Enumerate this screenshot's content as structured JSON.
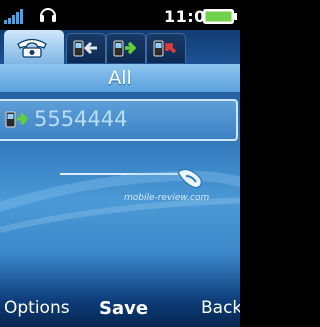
{
  "status_bar": {
    "time": "11:07",
    "signal_icon": "signal-bars-icon",
    "headset_icon": "headset-icon",
    "battery_icon": "battery-full-icon",
    "accent_colors": {
      "signal": "#4aa3e8",
      "battery": "#6fd24a"
    }
  },
  "tabs": [
    {
      "icon": "phone-icon",
      "active": true
    },
    {
      "icon": "missed-call-icon",
      "active": false
    },
    {
      "icon": "outgoing-call-icon",
      "active": false
    },
    {
      "icon": "incoming-call-icon",
      "active": false
    }
  ],
  "header": {
    "title": "All"
  },
  "entries": [
    {
      "number": "5554444",
      "icon": "outgoing-call-icon"
    }
  ],
  "watermark": "mobile-review.com",
  "softkeys": {
    "left": "Options",
    "center": "Save",
    "right": "Back"
  }
}
